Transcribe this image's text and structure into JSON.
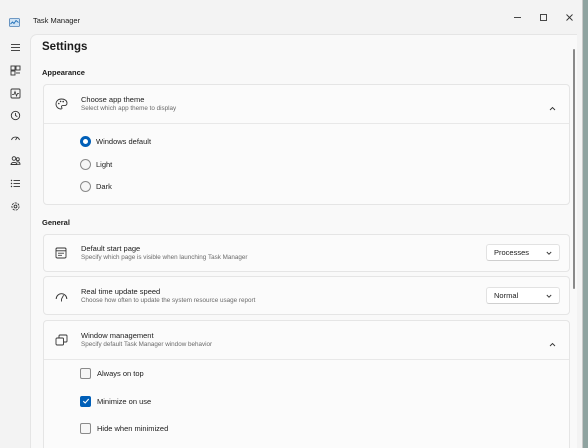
{
  "window": {
    "title": "Task Manager",
    "controls": [
      "minimize-icon",
      "maximize-icon",
      "close-icon"
    ]
  },
  "nav": {
    "items": [
      {
        "name": "hamburger-menu-icon"
      },
      {
        "name": "processes-icon"
      },
      {
        "name": "performance-icon"
      },
      {
        "name": "app-history-icon"
      },
      {
        "name": "startup-apps-icon"
      },
      {
        "name": "users-icon"
      },
      {
        "name": "details-icon"
      },
      {
        "name": "services-icon"
      }
    ]
  },
  "page": {
    "title": "Settings"
  },
  "appearance": {
    "section_title": "Appearance",
    "theme_card": {
      "icon": "palette-icon",
      "title": "Choose app theme",
      "subtitle": "Select which app theme to display",
      "options": [
        {
          "label": "Windows default",
          "selected": true
        },
        {
          "label": "Light",
          "selected": false
        },
        {
          "label": "Dark",
          "selected": false
        }
      ]
    }
  },
  "general": {
    "section_title": "General",
    "start_page": {
      "icon": "start-page-icon",
      "title": "Default start page",
      "subtitle": "Specify which page is visible when launching Task Manager",
      "value": "Processes"
    },
    "update_speed": {
      "icon": "speed-gauge-icon",
      "title": "Real time update speed",
      "subtitle": "Choose how often to update the system resource usage report",
      "value": "Normal"
    },
    "window_management": {
      "icon": "window-management-icon",
      "title": "Window management",
      "subtitle": "Specify default Task Manager window behavior",
      "options": [
        {
          "label": "Always on top",
          "checked": false
        },
        {
          "label": "Minimize on use",
          "checked": true
        },
        {
          "label": "Hide when minimized",
          "checked": false
        }
      ]
    }
  },
  "colors": {
    "accent": "#005fb8",
    "window_bg": "#f3f3f3",
    "content_bg": "#f9f9f9",
    "desktop_bg": "#8fa3a0"
  }
}
